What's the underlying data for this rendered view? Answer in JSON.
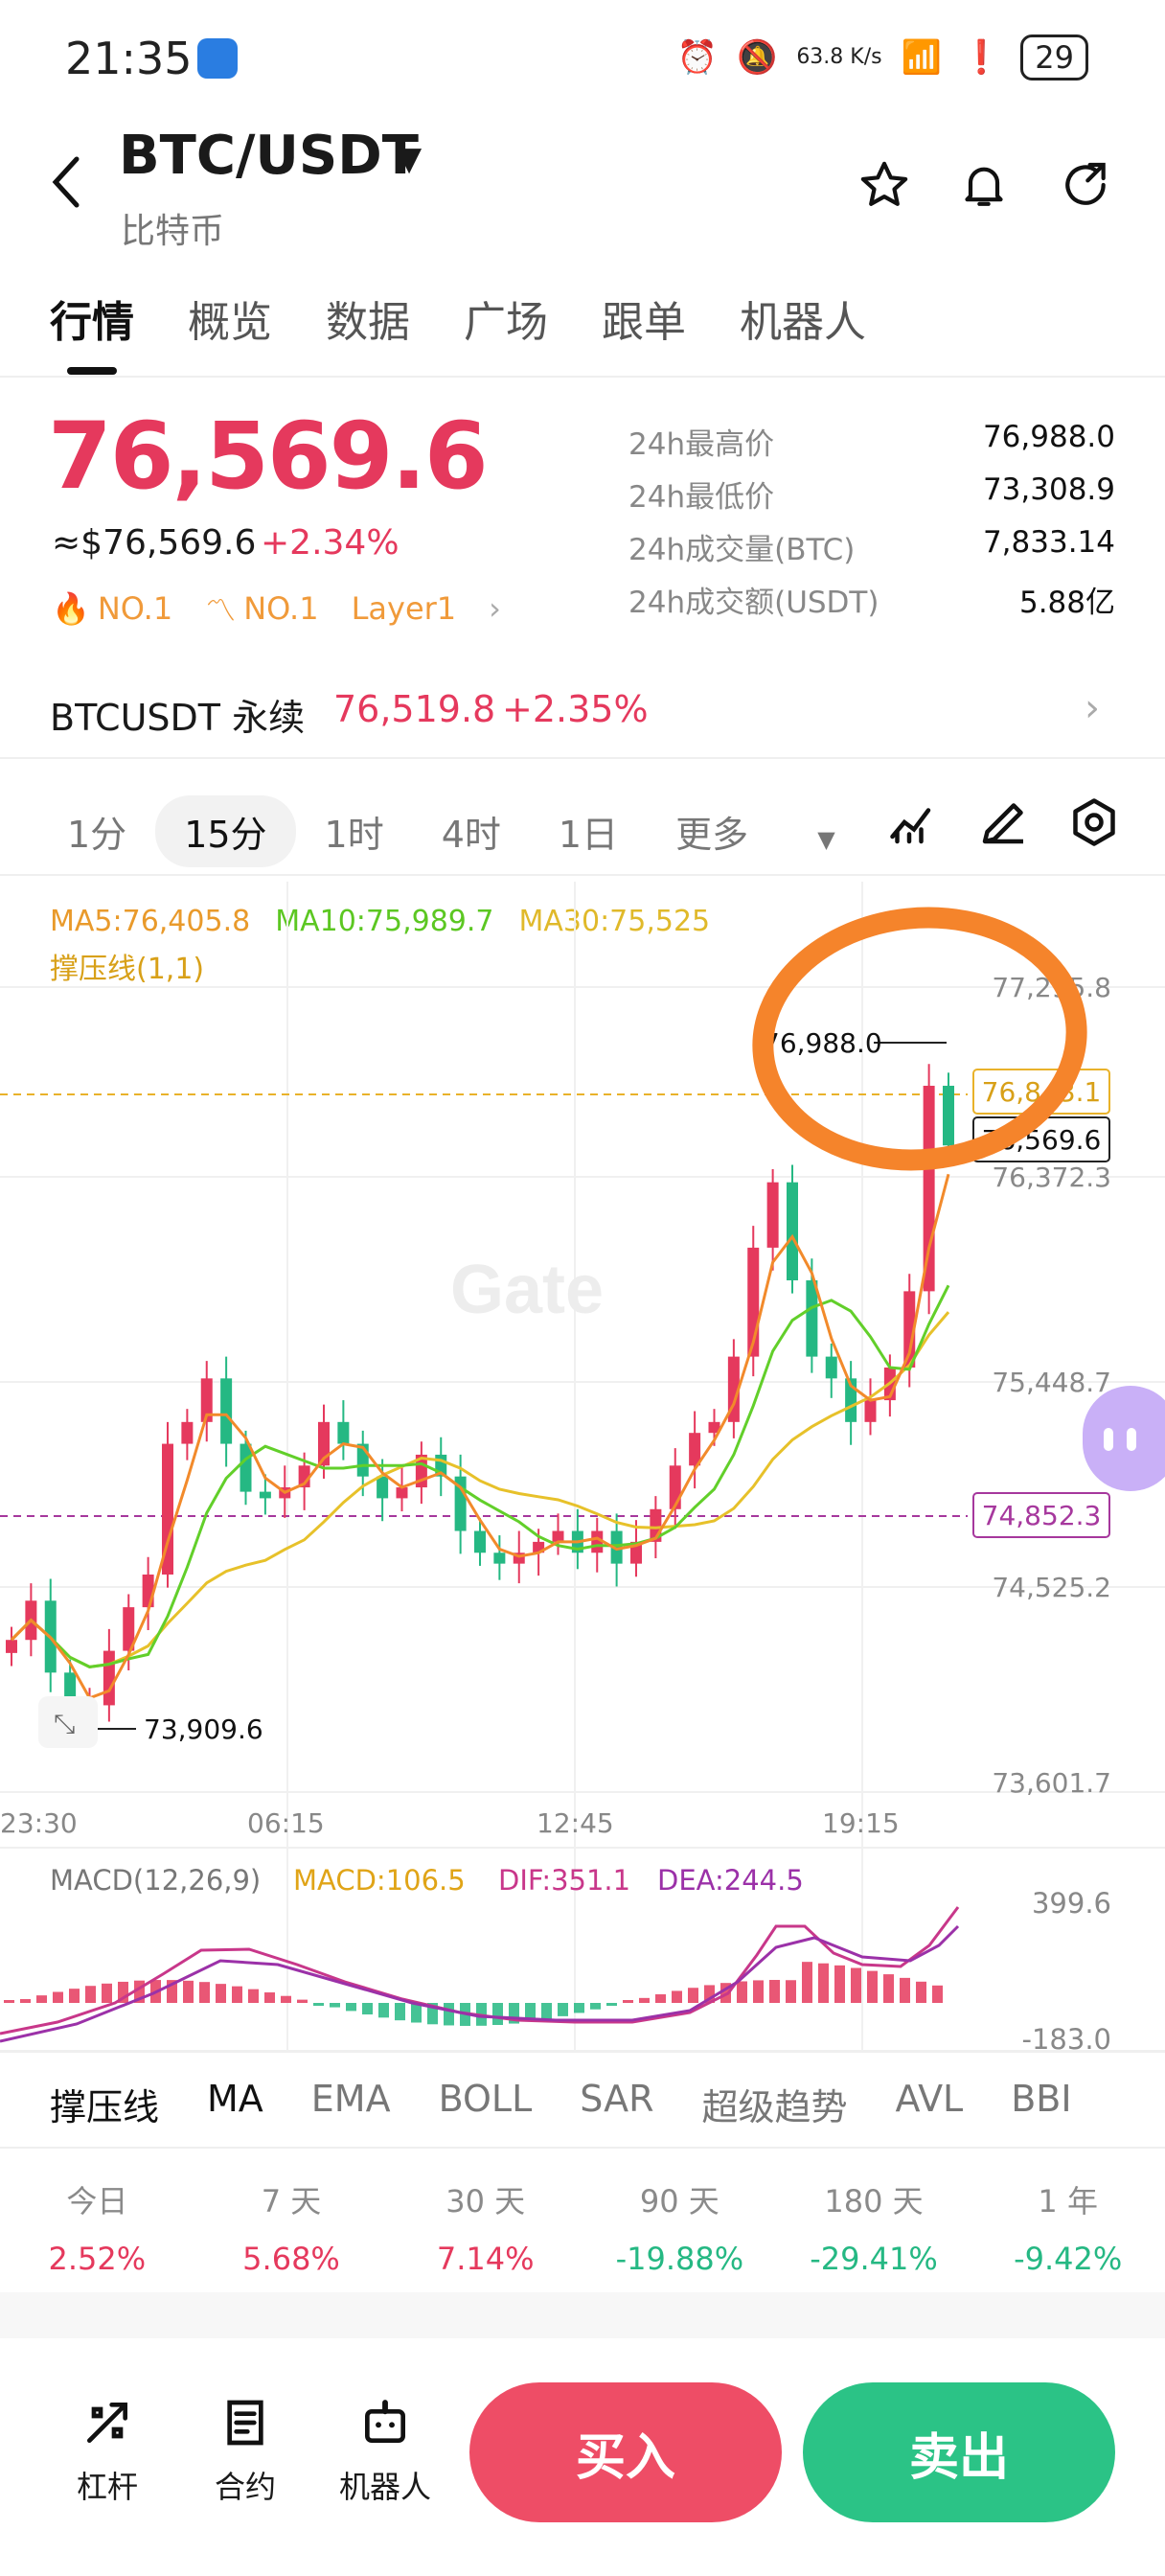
{
  "status_bar": {
    "time": "21:35",
    "net_speed": "63.8 K/s",
    "battery": "29"
  },
  "header": {
    "pair": "BTC/USDT",
    "subtitle": "比特币"
  },
  "tabs": [
    {
      "label": "行情",
      "active": true
    },
    {
      "label": "概览"
    },
    {
      "label": "数据"
    },
    {
      "label": "广场"
    },
    {
      "label": "跟单"
    },
    {
      "label": "机器人"
    }
  ],
  "price": {
    "last": "76,569.6",
    "usd": "≈$76,569.6",
    "change": "+2.34%",
    "rank1": "NO.1",
    "rank2": "NO.1",
    "tag": "Layer1"
  },
  "stats": [
    {
      "label": "24h最高价",
      "value": "76,988.0"
    },
    {
      "label": "24h最低价",
      "value": "73,308.9"
    },
    {
      "label": "24h成交量(BTC)",
      "value": "7,833.14"
    },
    {
      "label": "24h成交额(USDT)",
      "value": "5.88亿"
    }
  ],
  "perp": {
    "label": "BTCUSDT 永续",
    "price": "76,519.8",
    "change": "+2.35%"
  },
  "intervals": {
    "items": [
      "1分",
      "15分",
      "1时",
      "4时",
      "1日"
    ],
    "selected": "15分",
    "more": "更多"
  },
  "ma": {
    "ma5": "MA5:76,405.8",
    "ma10": "MA10:75,989.7",
    "ma30": "MA30:75,525",
    "support": "撑压线(1,1)"
  },
  "colors": {
    "up": "#e5395d",
    "down": "#25b883",
    "ma5": "#f28a2b",
    "ma10": "#62cf2a",
    "ma30": "#e7c12a",
    "annotation": "#f5842b"
  },
  "chart_data": {
    "type": "candlestick",
    "interval": "15分",
    "y_ticks": [
      "77,295.8",
      "76,372.3",
      "75,448.7",
      "74,525.2",
      "73,601.7"
    ],
    "x_ticks": [
      "23:30",
      "06:15",
      "12:45",
      "19:15"
    ],
    "high_label": "76,988.0",
    "low_label": "73,909.6",
    "current_price_tag": "76,569.6",
    "dashed_level_tag": "76,843.1",
    "support_level_tag": "74,852.3",
    "ylim": [
      73601.7,
      77295.8
    ],
    "closes": [
      74300,
      74480,
      74150,
      73950,
      74000,
      74250,
      74450,
      74600,
      75200,
      75300,
      75500,
      75200,
      74980,
      74950,
      75000,
      75100,
      75300,
      75200,
      75050,
      74950,
      75000,
      75150,
      75050,
      74800,
      74700,
      74650,
      74700,
      74750,
      74800,
      74700,
      74800,
      74650,
      74750,
      74900,
      75100,
      75250,
      75300,
      75600,
      76100,
      76400,
      75950,
      75600,
      75500,
      75300,
      75400,
      75550,
      75900,
      76843,
      76569
    ]
  },
  "macd": {
    "title": "MACD(12,26,9)",
    "macd": "MACD:106.5",
    "dif": "DIF:351.1",
    "dea": "DEA:244.5",
    "top": "399.6",
    "bottom": "-183.0"
  },
  "indicators": [
    "撑压线",
    "MA",
    "EMA",
    "BOLL",
    "SAR",
    "超级趋势",
    "AVL",
    "BBI"
  ],
  "periods": [
    {
      "label": "今日",
      "value": "2.52%"
    },
    {
      "label": "7 天",
      "value": "5.68%"
    },
    {
      "label": "30 天",
      "value": "7.14%"
    },
    {
      "label": "90 天",
      "value": "-19.88%"
    },
    {
      "label": "180 天",
      "value": "-29.41%"
    },
    {
      "label": "1 年",
      "value": "-9.42%"
    }
  ],
  "bottom": {
    "leverage": "杠杆",
    "futures": "合约",
    "bot": "机器人",
    "buy": "买入",
    "sell": "卖出"
  },
  "watermark": "Gate"
}
